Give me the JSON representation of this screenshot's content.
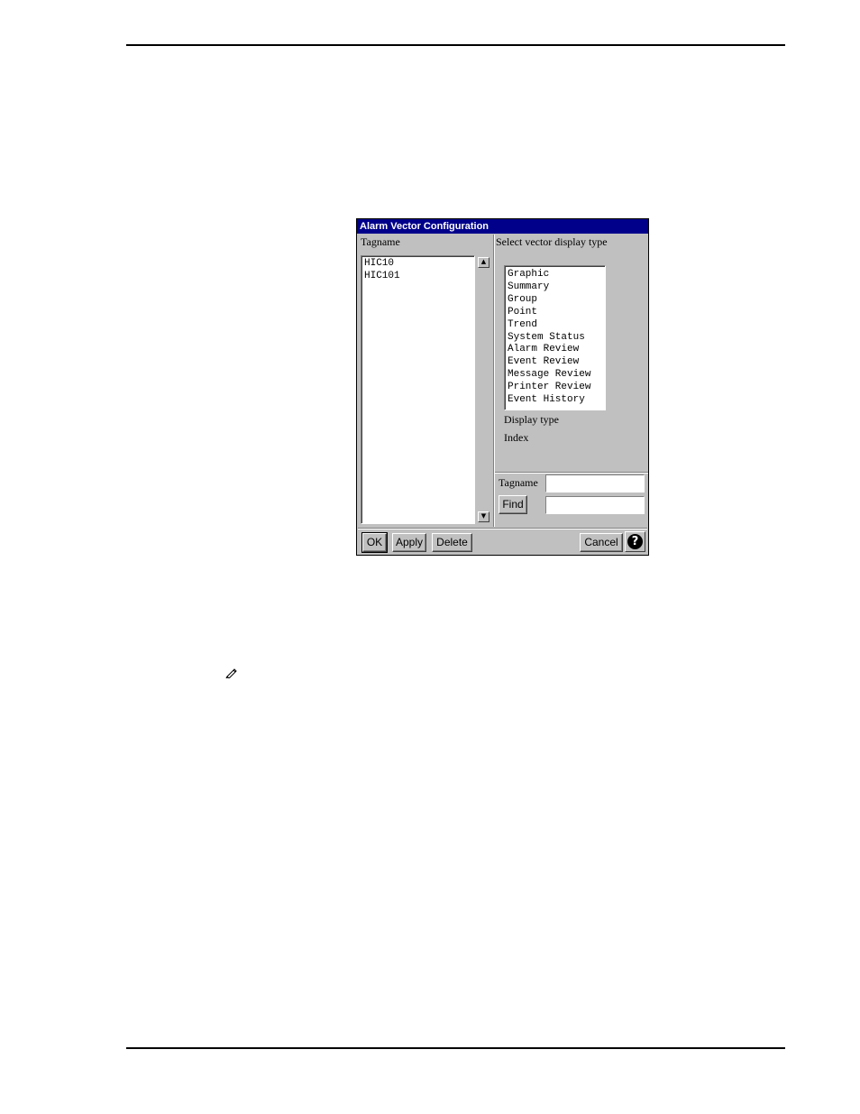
{
  "dialog": {
    "title": "Alarm Vector Configuration",
    "left_label": "Tagname",
    "tag_list": [
      "HIC10",
      "HIC101"
    ],
    "right_label": "Select vector display type",
    "display_types": [
      "Graphic",
      "Summary",
      "Group",
      "Point",
      "Trend",
      "System Status",
      "Alarm Review",
      "Event Review",
      "Message Review",
      "Printer Review",
      "Event History"
    ],
    "display_type_label": "Display type",
    "index_label": "Index",
    "search": {
      "tagname_label": "Tagname",
      "tagname_value": "",
      "find_label": "Find",
      "find_value": ""
    },
    "buttons": {
      "ok": "OK",
      "apply": "Apply",
      "delete": "Delete",
      "cancel": "Cancel",
      "help": "?"
    },
    "scroll_up_icon": "scroll-up-arrow",
    "scroll_down_icon": "scroll-down-arrow"
  },
  "page": {
    "note_icon": "pencil-icon"
  },
  "colors": {
    "titlebar": "#00008b",
    "dialog_bg": "#c0c0c0"
  }
}
